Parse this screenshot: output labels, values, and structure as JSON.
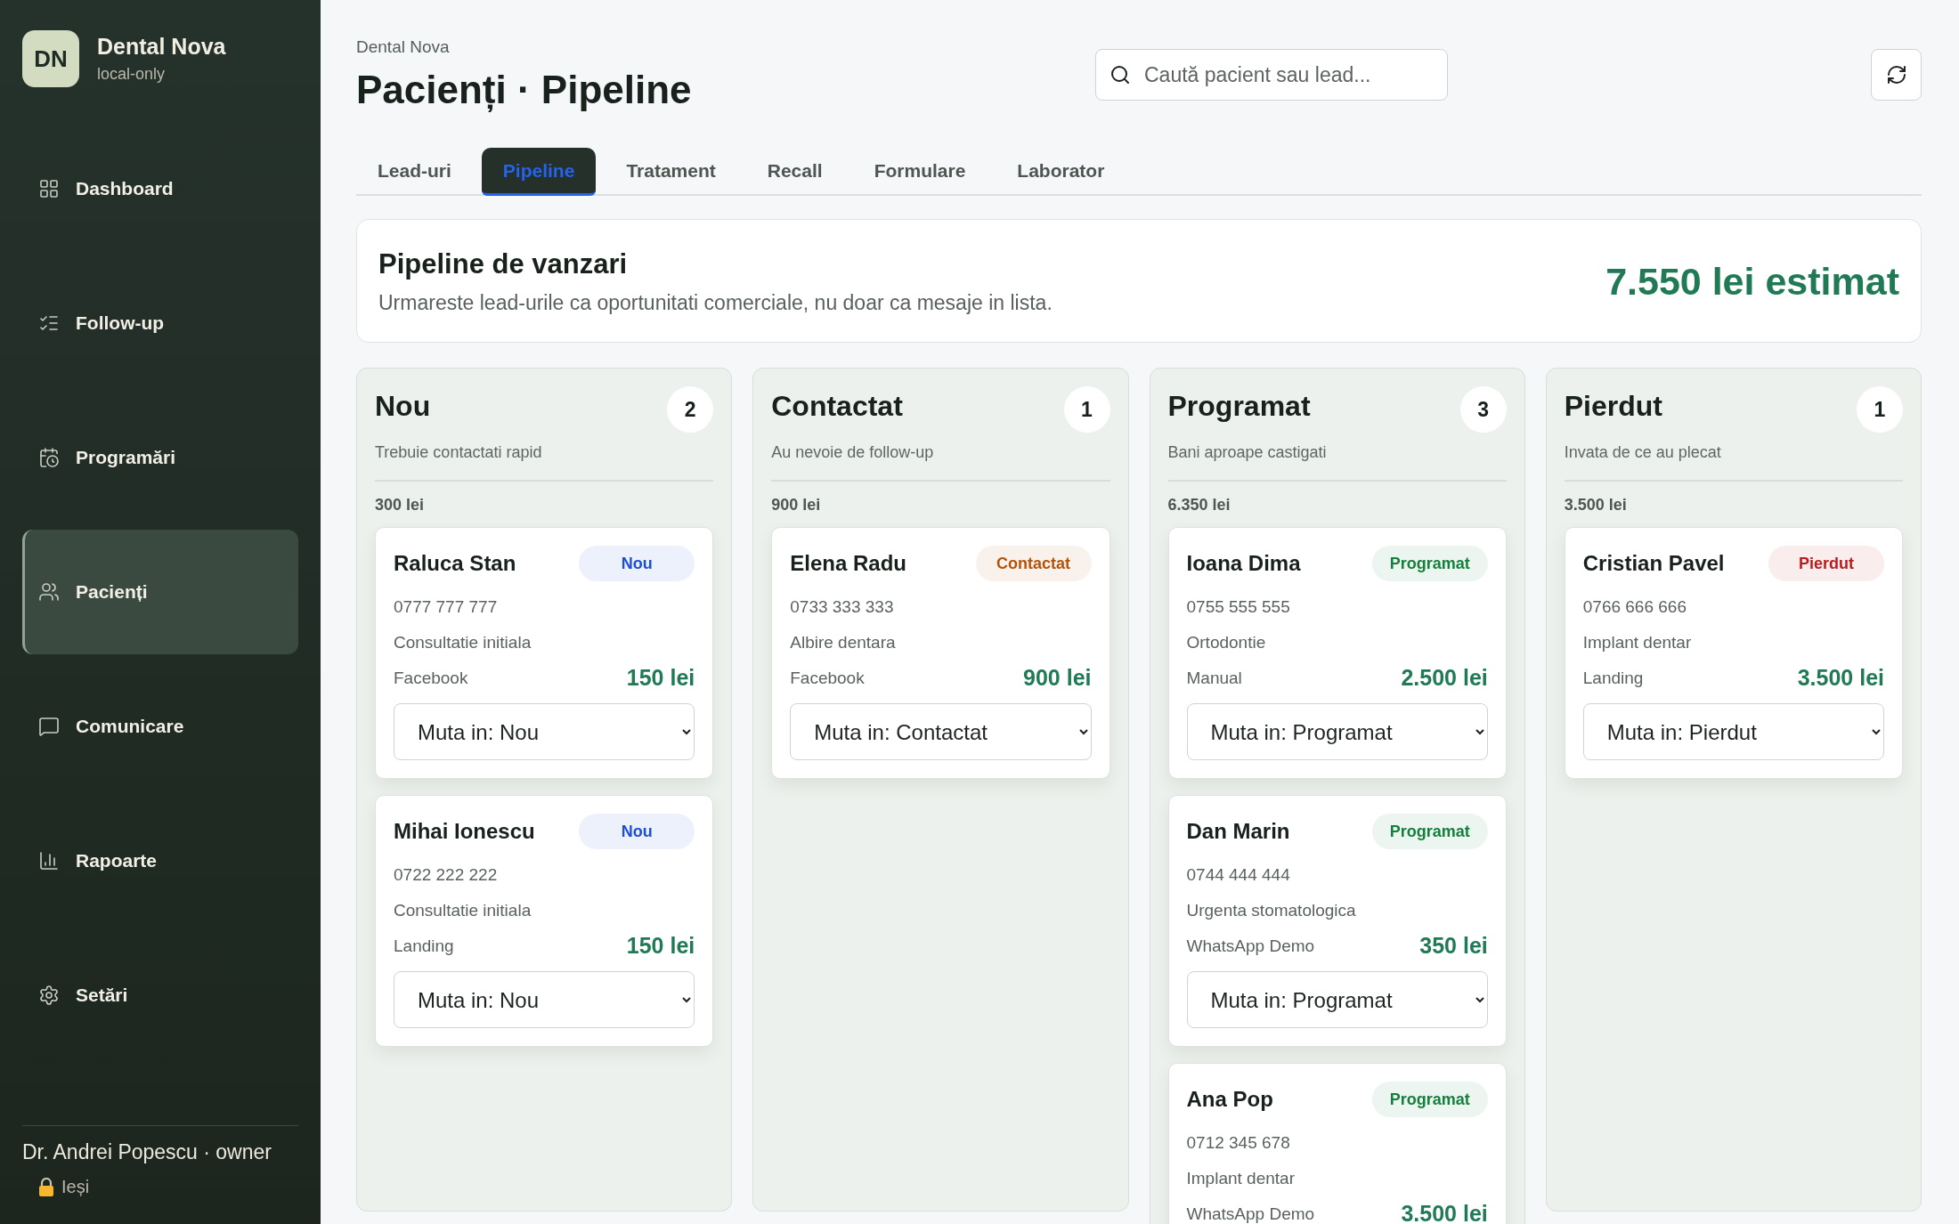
{
  "sidebar": {
    "logo": "DN",
    "brand": "Dental Nova",
    "subtitle": "local-only",
    "items": [
      {
        "label": "Dashboard",
        "kind": "dashboard",
        "selected": false
      },
      {
        "label": "Follow-up",
        "kind": "followup",
        "selected": false
      },
      {
        "label": "Programări",
        "kind": "calendar",
        "selected": false
      },
      {
        "label": "Pacienți",
        "kind": "patients",
        "selected": true
      },
      {
        "label": "Comunicare",
        "kind": "chat",
        "selected": false
      },
      {
        "label": "Rapoarte",
        "kind": "reports",
        "selected": false
      },
      {
        "label": "Setări",
        "kind": "settings",
        "selected": false
      }
    ],
    "user": "Dr. Andrei Popescu · owner",
    "logout": "Ieși"
  },
  "header": {
    "breadcrumb": "Dental Nova",
    "title": "Pacienți · Pipeline",
    "search": {
      "placeholder": "Caută pacient sau lead..."
    }
  },
  "tabs": [
    {
      "label": "Lead-uri",
      "selected": false
    },
    {
      "label": "Pipeline",
      "selected": true
    },
    {
      "label": "Tratament",
      "selected": false
    },
    {
      "label": "Recall",
      "selected": false
    },
    {
      "label": "Formulare",
      "selected": false
    },
    {
      "label": "Laborator",
      "selected": false
    }
  ],
  "summary": {
    "title": "Pipeline de vanzari",
    "text": "Urmareste lead-urile ca oportunitati comerciale, nu doar ca mesaje in lista.",
    "estimate": "7.550 lei estimat"
  },
  "columns": [
    {
      "title": "Nou",
      "count": "2",
      "subtitle": "Trebuie contactati rapid",
      "total": "300 lei",
      "cards": [
        {
          "name": "Raluca Stan",
          "badge": {
            "text": "Nou",
            "color": "#1d4ed8"
          },
          "phone": "0777 777 777",
          "service": "Consultatie initiala",
          "source": "Facebook",
          "amount": "150 lei",
          "select": "Muta in: Nou"
        },
        {
          "name": "Mihai Ionescu",
          "badge": {
            "text": "Nou",
            "color": "#1d4ed8"
          },
          "phone": "0722 222 222",
          "service": "Consultatie initiala",
          "source": "Landing",
          "amount": "150 lei",
          "select": "Muta in: Nou"
        }
      ]
    },
    {
      "title": "Contactat",
      "count": "1",
      "subtitle": "Au nevoie de follow-up",
      "total": "900 lei",
      "cards": [
        {
          "name": "Elena Radu",
          "badge": {
            "text": "Contactat",
            "color": "#b45309"
          },
          "phone": "0733 333 333",
          "service": "Albire dentara",
          "source": "Facebook",
          "amount": "900 lei",
          "select": "Muta in: Contactat"
        }
      ]
    },
    {
      "title": "Programat",
      "count": "3",
      "subtitle": "Bani aproape castigati",
      "total": "6.350 lei",
      "cards": [
        {
          "name": "Ioana Dima",
          "badge": {
            "text": "Programat",
            "color": "#15803d"
          },
          "phone": "0755 555 555",
          "service": "Ortodontie",
          "source": "Manual",
          "amount": "2.500 lei",
          "select": "Muta in: Programat"
        },
        {
          "name": "Dan Marin",
          "badge": {
            "text": "Programat",
            "color": "#15803d"
          },
          "phone": "0744 444 444",
          "service": "Urgenta stomatologica",
          "source": "WhatsApp Demo",
          "amount": "350 lei",
          "select": "Muta in: Programat"
        },
        {
          "name": "Ana Pop",
          "badge": {
            "text": "Programat",
            "color": "#15803d"
          },
          "phone": "0712 345 678",
          "service": "Implant dentar",
          "source": "WhatsApp Demo",
          "amount": "3.500 lei"
        }
      ]
    },
    {
      "title": "Pierdut",
      "count": "1",
      "subtitle": "Invata de ce au plecat",
      "total": "3.500 lei",
      "cards": [
        {
          "name": "Cristian Pavel",
          "badge": {
            "text": "Pierdut",
            "color": "#b91c1c"
          },
          "phone": "0766 666 666",
          "service": "Implant dentar",
          "source": "Landing",
          "amount": "3.500 lei",
          "select": "Muta in: Pierdut"
        }
      ]
    }
  ]
}
